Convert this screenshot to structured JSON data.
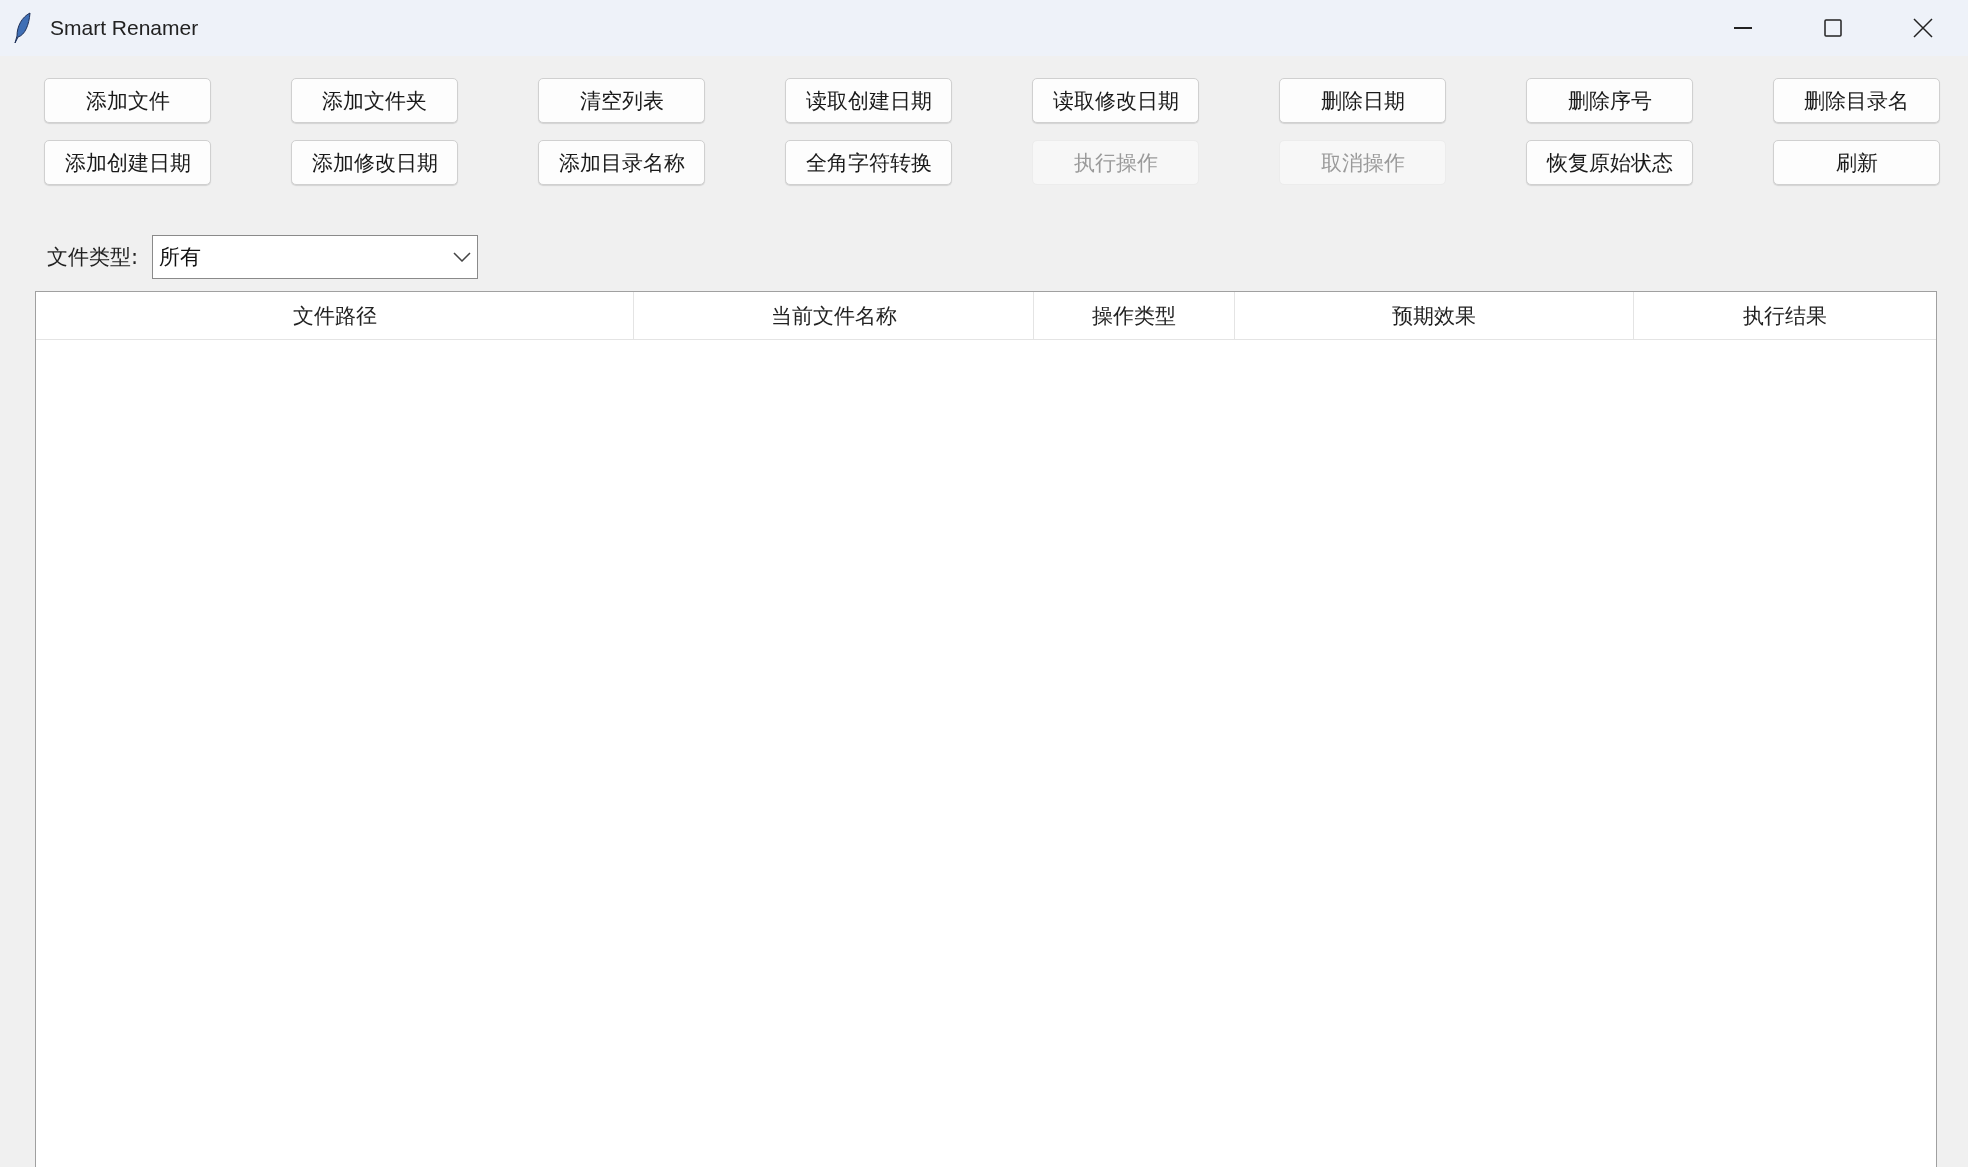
{
  "window": {
    "title": "Smart Renamer"
  },
  "buttons": [
    {
      "label": "添加文件",
      "disabled": false
    },
    {
      "label": "添加文件夹",
      "disabled": false
    },
    {
      "label": "清空列表",
      "disabled": false
    },
    {
      "label": "读取创建日期",
      "disabled": false
    },
    {
      "label": "读取修改日期",
      "disabled": false
    },
    {
      "label": "删除日期",
      "disabled": false
    },
    {
      "label": "删除序号",
      "disabled": false
    },
    {
      "label": "删除目录名",
      "disabled": false
    },
    {
      "label": "添加创建日期",
      "disabled": false
    },
    {
      "label": "添加修改日期",
      "disabled": false
    },
    {
      "label": "添加目录名称",
      "disabled": false
    },
    {
      "label": "全角字符转换",
      "disabled": false
    },
    {
      "label": "执行操作",
      "disabled": true
    },
    {
      "label": "取消操作",
      "disabled": true
    },
    {
      "label": "恢复原始状态",
      "disabled": false
    },
    {
      "label": "刷新",
      "disabled": false
    }
  ],
  "file_type": {
    "label": "文件类型:",
    "value": "所有"
  },
  "table": {
    "columns": [
      "文件路径",
      "当前文件名称",
      "操作类型",
      "预期效果",
      "执行结果"
    ]
  }
}
